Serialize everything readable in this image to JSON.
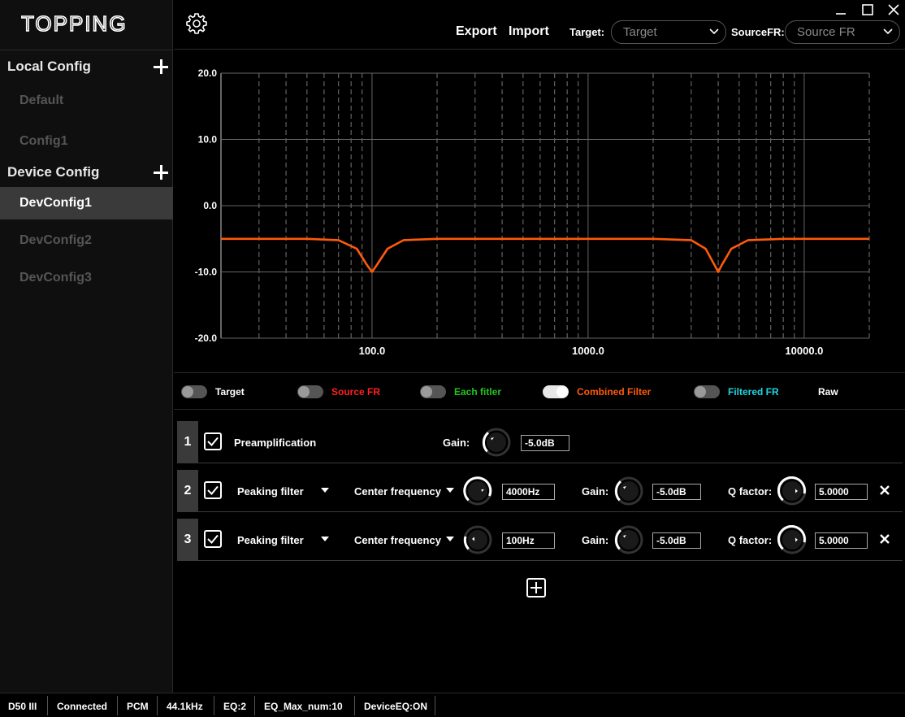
{
  "app": {
    "logo_text": "TOPPING"
  },
  "sidebar": {
    "local_config": {
      "title": "Local Config",
      "items": [
        "Default",
        "Config1"
      ]
    },
    "device_config": {
      "title": "Device Config",
      "items": [
        "DevConfig1",
        "DevConfig2",
        "DevConfig3"
      ],
      "active": "DevConfig1"
    }
  },
  "topbar": {
    "export_label": "Export",
    "import_label": "Import",
    "target_label": "Target:",
    "target_value": "Target",
    "sourcefr_label": "SourceFR:",
    "sourcefr_value": "Source FR"
  },
  "chart_data": {
    "type": "line",
    "xscale": "log",
    "xlim": [
      20,
      20000
    ],
    "ylim": [
      -20,
      20
    ],
    "x_ticks": [
      "100.0",
      "1000.0",
      "10000.0"
    ],
    "y_ticks": [
      "20.0",
      "10.0",
      "0.0",
      "-10.0",
      "-20.0"
    ],
    "grid": true,
    "series": [
      {
        "name": "Combined Filter",
        "color": "#ff5a0a",
        "x": [
          20,
          50,
          70,
          85,
          95,
          100,
          105,
          118,
          140,
          200,
          500,
          1000,
          2000,
          3000,
          3500,
          3850,
          4000,
          4150,
          4600,
          5500,
          8000,
          12000,
          20000
        ],
        "y": [
          -5.0,
          -5.0,
          -5.2,
          -6.5,
          -9.0,
          -10.0,
          -9.0,
          -6.5,
          -5.2,
          -5.0,
          -5.0,
          -5.0,
          -5.0,
          -5.2,
          -6.5,
          -9.0,
          -10.0,
          -9.0,
          -6.5,
          -5.2,
          -5.0,
          -5.0,
          -5.0
        ]
      }
    ]
  },
  "toggles": [
    {
      "label": "Target",
      "color": "#ffffff",
      "on": false
    },
    {
      "label": "Source FR",
      "color": "#ff2020",
      "on": false
    },
    {
      "label": "Each fitler",
      "color": "#22c422",
      "on": false
    },
    {
      "label": "Combined Filter",
      "color": "#ff5a0a",
      "on": true
    },
    {
      "label": "Filtered FR",
      "color": "#1fd6e0",
      "on": false
    },
    {
      "label": "Raw",
      "color": "#ffffff",
      "on": null
    }
  ],
  "filters": {
    "preamp": {
      "index": "1",
      "label": "Preamplification",
      "gain_label": "Gain:",
      "gain": "-5.0dB"
    },
    "rows": [
      {
        "index": "2",
        "type": "Peaking filter",
        "freq_label": "Center frequency",
        "freq": "4000Hz",
        "gain_label": "Gain:",
        "gain": "-5.0dB",
        "q_label": "Q factor:",
        "q": "5.0000"
      },
      {
        "index": "3",
        "type": "Peaking filter",
        "freq_label": "Center frequency",
        "freq": "100Hz",
        "gain_label": "Gain:",
        "gain": "-5.0dB",
        "q_label": "Q factor:",
        "q": "5.0000"
      }
    ]
  },
  "statusbar": [
    "D50 III",
    "Connected",
    "PCM",
    "44.1kHz",
    "EQ:2",
    "EQ_Max_num:10",
    "DeviceEQ:ON"
  ]
}
